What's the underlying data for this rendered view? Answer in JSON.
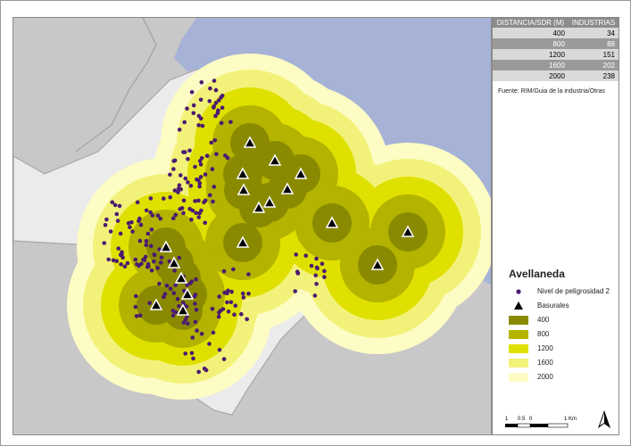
{
  "table": {
    "header_distance": "DISTANCIA/SDR (M)",
    "header_industries": "INDUSTRIAS",
    "rows": [
      {
        "distance": "400",
        "industries": "34"
      },
      {
        "distance": "800",
        "industries": "88"
      },
      {
        "distance": "1200",
        "industries": "151"
      },
      {
        "distance": "1600",
        "industries": "202"
      },
      {
        "distance": "2000",
        "industries": "238"
      }
    ]
  },
  "source": "Fuente: RIM/Guia de la industria/Otras",
  "legend": {
    "title": "Avellaneda",
    "points_label": "Nivel de peligrosidad 2",
    "triangles_label": "Basurales",
    "buffers": [
      {
        "label": "400",
        "color": "#8a8a00"
      },
      {
        "label": "800",
        "color": "#b3b300"
      },
      {
        "label": "1200",
        "color": "#e0e000"
      },
      {
        "label": "1600",
        "color": "#f2f27a"
      },
      {
        "label": "2000",
        "color": "#fcfcc4"
      }
    ]
  },
  "scale": {
    "t0": "1",
    "t1": "0.5",
    "t2": "0",
    "t3": "1 Km"
  },
  "colors": {
    "water": "#a6b2d6",
    "land": "#c8c8c8",
    "district": "#ebebeb",
    "point": "#4b1a70"
  }
}
